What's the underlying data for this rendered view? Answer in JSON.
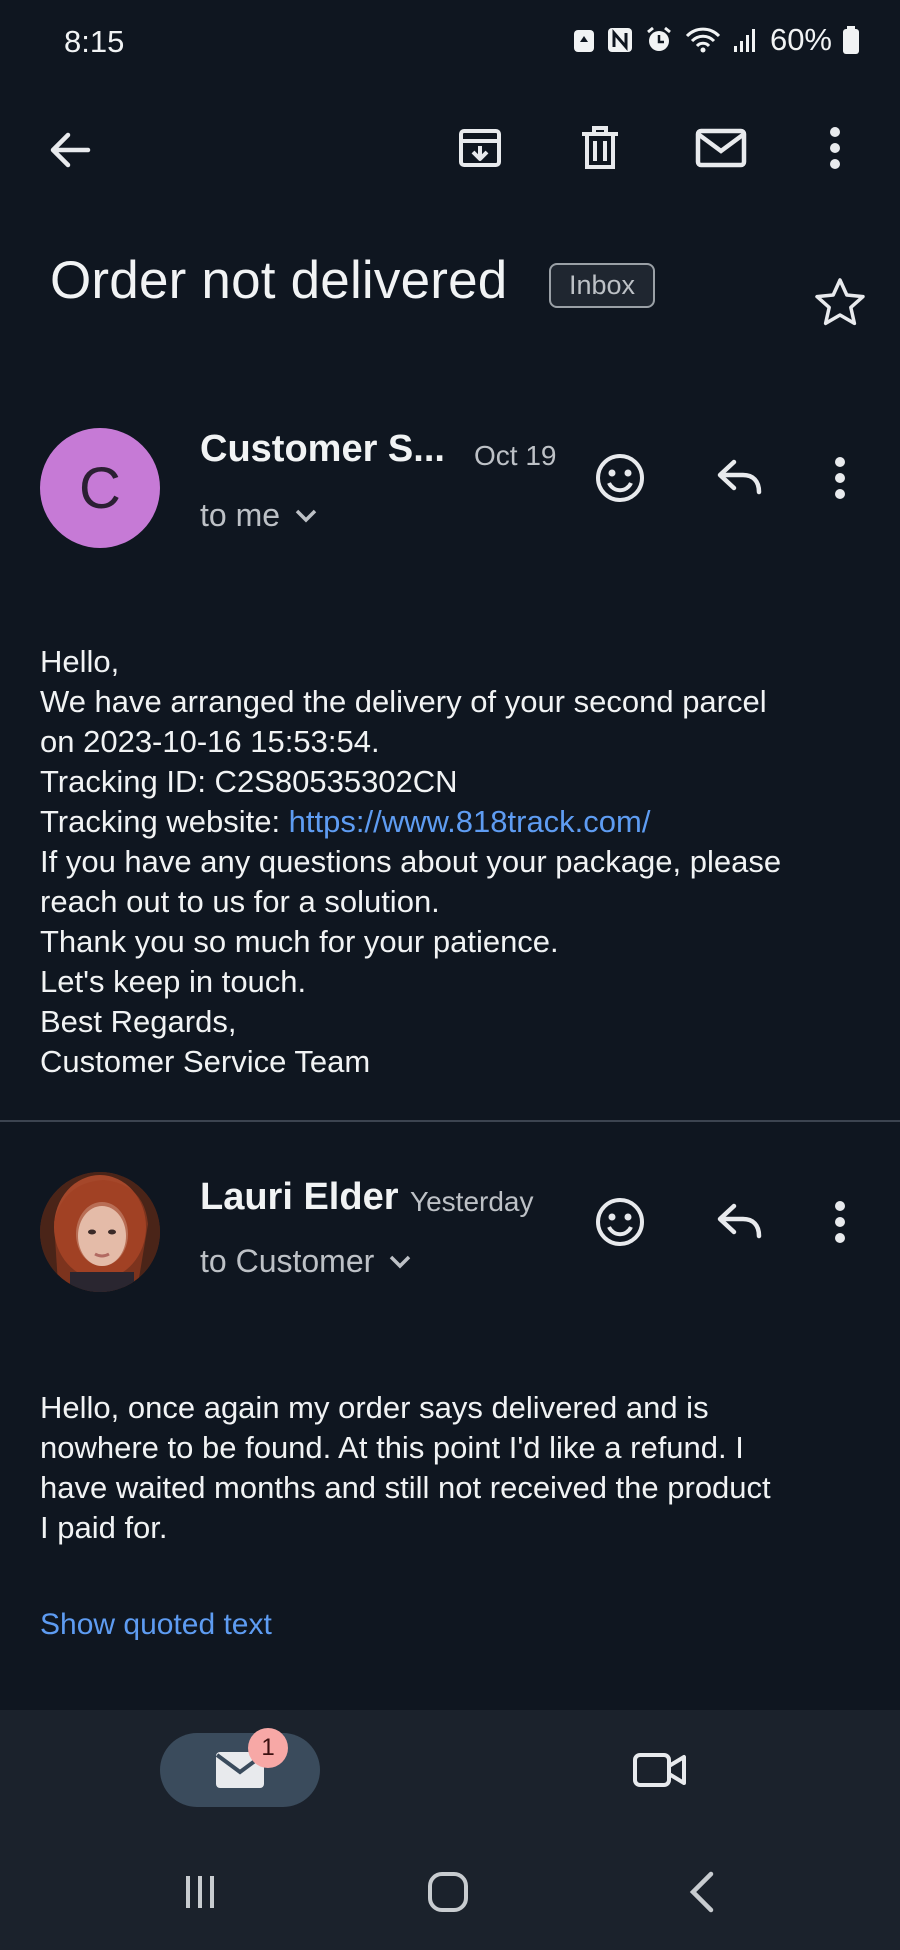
{
  "status_bar": {
    "time": "8:15",
    "battery": "60%"
  },
  "toolbar": {
    "back_icon": "arrow-left-icon",
    "archive_icon": "archive-icon",
    "delete_icon": "trash-icon",
    "mark_unread_icon": "mail-icon",
    "more_icon": "more-vert-icon"
  },
  "thread": {
    "subject": "Order not delivered",
    "label": "Inbox"
  },
  "messages": [
    {
      "avatar_letter": "C",
      "avatar_color": "#c67ad6",
      "sender": "Customer S...",
      "date": "Oct 19",
      "recipient": "to me",
      "body": {
        "l1": "Hello,",
        "l2": "We have arranged the delivery of your second parcel",
        "l3": "on 2023-10-16 15:53:54.",
        "l4": "Tracking ID: C2S80535302CN",
        "l5_prefix": "Tracking website: ",
        "l5_link": "https://www.818track.com/",
        "l6": "If you have any questions about your package, please",
        "l7": "reach out to us for a solution.",
        "l8": "Thank you so much for your patience.",
        "l9": "Let's keep in touch.",
        "l10": "Best Regards,",
        "l11": "Customer Service Team"
      }
    },
    {
      "sender": "Lauri Elder",
      "date": "Yesterday",
      "recipient": "to Customer",
      "body": {
        "l1": "Hello, once again my order says delivered and is",
        "l2": "nowhere to be found. At this point I'd like a refund. I",
        "l3": "have waited months and still not received the product",
        "l4": "I paid for."
      },
      "show_quoted": "Show quoted text"
    }
  ],
  "bottom_nav": {
    "mail_badge": "1"
  },
  "colors": {
    "background": "#0f1620",
    "link": "#5e9cf2",
    "nav_bar": "#1b222c"
  }
}
